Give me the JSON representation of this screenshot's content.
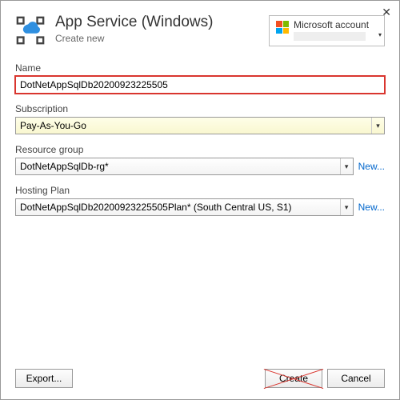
{
  "header": {
    "title": "App Service (Windows)",
    "subtitle": "Create new"
  },
  "account": {
    "label": "Microsoft account"
  },
  "fields": {
    "name": {
      "label": "Name",
      "value": "DotNetAppSqlDb20200923225505"
    },
    "subscription": {
      "label": "Subscription",
      "value": "Pay-As-You-Go"
    },
    "resourceGroup": {
      "label": "Resource group",
      "value": "DotNetAppSqlDb-rg*",
      "newLink": "New..."
    },
    "hostingPlan": {
      "label": "Hosting Plan",
      "value": "DotNetAppSqlDb20200923225505Plan* (South Central US, S1)",
      "newLink": "New..."
    }
  },
  "buttons": {
    "export": "Export...",
    "create": "Create",
    "cancel": "Cancel"
  }
}
